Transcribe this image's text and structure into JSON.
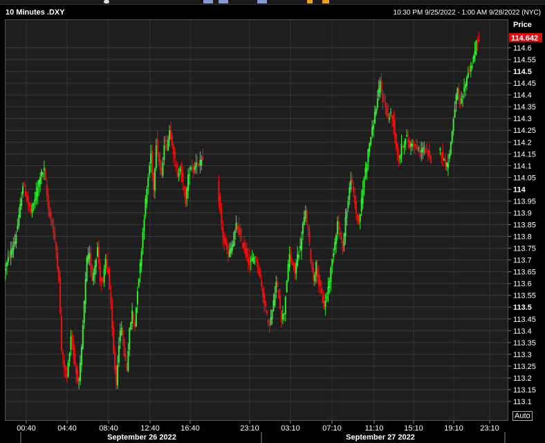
{
  "header": {
    "title": "10 Minutes .DXY",
    "date_range": "10:30 PM 9/25/2022 - 1:00 AM 9/28/2022 (NYC)"
  },
  "axis": {
    "price_header": "Price",
    "auto_label": "Auto",
    "last_price": "114.642"
  },
  "toolbar_icons": [
    "window-icon",
    "grid-icon",
    "bar-icon",
    "chart-icon",
    "warning-icon",
    "menu-icon"
  ],
  "chart_data": {
    "type": "candlestick",
    "title": "10 Minutes .DXY",
    "ylabel": "Price",
    "ylim": [
      113.03,
      114.73
    ],
    "x_tick_labels": [
      "00:40",
      "04:40",
      "08:40",
      "12:40",
      "16:40",
      "23:10",
      "03:10",
      "07:10",
      "11:10",
      "15:10",
      "19:10",
      "23:10"
    ],
    "date_labels": [
      "September 26 2022",
      "September 27 2022"
    ],
    "y_ticks": [
      113.1,
      113.15,
      113.2,
      113.25,
      113.3,
      113.35,
      113.4,
      113.45,
      113.5,
      113.55,
      113.6,
      113.65,
      113.7,
      113.75,
      113.8,
      113.85,
      113.9,
      113.95,
      114.0,
      114.05,
      114.1,
      114.15,
      114.2,
      114.25,
      114.3,
      114.35,
      114.4,
      114.45,
      114.5,
      114.55,
      114.6
    ],
    "y_tick_labels": [
      "113.1",
      "113.15",
      "113.2",
      "113.25",
      "113.3",
      "113.35",
      "113.4",
      "113.45",
      "113.5",
      "113.55",
      "113.6",
      "113.65",
      "113.7",
      "113.75",
      "113.8",
      "113.85",
      "113.9",
      "113.95",
      "114",
      "114.05",
      "114.1",
      "114.15",
      "114.2",
      "114.25",
      "114.3",
      "114.35",
      "114.4",
      "114.45",
      "114.5",
      "114.55",
      "114.6"
    ],
    "bold_ticks": [
      "113.5",
      "114",
      "114.5"
    ],
    "last_price": 114.642,
    "up_color": "#33ee33",
    "down_color": "#ee1111",
    "grid": true,
    "path": [
      [
        0,
        113.65
      ],
      [
        4,
        113.72
      ],
      [
        8,
        113.78
      ],
      [
        11,
        113.88
      ],
      [
        14,
        114.02
      ],
      [
        17,
        113.96
      ],
      [
        20,
        113.9
      ],
      [
        24,
        113.98
      ],
      [
        27,
        114.06
      ],
      [
        30,
        114.08
      ],
      [
        33,
        113.92
      ],
      [
        36,
        113.85
      ],
      [
        39,
        113.74
      ],
      [
        41,
        113.62
      ],
      [
        43,
        113.32
      ],
      [
        45,
        113.25
      ],
      [
        47,
        113.2
      ],
      [
        50,
        113.38
      ],
      [
        52,
        113.3
      ],
      [
        54,
        113.22
      ],
      [
        56,
        113.18
      ],
      [
        58,
        113.32
      ],
      [
        60,
        113.52
      ],
      [
        62,
        113.7
      ],
      [
        64,
        113.72
      ],
      [
        66,
        113.62
      ],
      [
        68,
        113.68
      ],
      [
        70,
        113.75
      ],
      [
        72,
        113.62
      ],
      [
        74,
        113.6
      ],
      [
        76,
        113.7
      ],
      [
        78,
        113.65
      ],
      [
        80,
        113.5
      ],
      [
        82,
        113.3
      ],
      [
        84,
        113.18
      ],
      [
        86,
        113.35
      ],
      [
        88,
        113.42
      ],
      [
        90,
        113.3
      ],
      [
        92,
        113.24
      ],
      [
        94,
        113.4
      ],
      [
        96,
        113.48
      ],
      [
        98,
        113.42
      ],
      [
        100,
        113.58
      ],
      [
        102,
        113.68
      ],
      [
        104,
        113.82
      ],
      [
        106,
        113.95
      ],
      [
        108,
        114.05
      ],
      [
        110,
        114.15
      ],
      [
        112,
        114.0
      ],
      [
        114,
        114.2
      ],
      [
        116,
        114.12
      ],
      [
        118,
        114.05
      ],
      [
        120,
        114.2
      ],
      [
        122,
        114.18
      ],
      [
        124,
        114.25
      ],
      [
        126,
        114.2
      ],
      [
        128,
        114.12
      ],
      [
        130,
        114.05
      ],
      [
        132,
        114.1
      ],
      [
        134,
        114.02
      ],
      [
        136,
        113.95
      ],
      [
        138,
        114.05
      ],
      [
        140,
        114.1
      ],
      [
        142,
        114.08
      ],
      [
        144,
        114.12
      ],
      [
        146,
        114.1
      ],
      [
        148,
        114.12
      ],
      [
        149,
        114.11
      ]
    ],
    "path2": [
      [
        160,
        114.02
      ],
      [
        162,
        113.9
      ],
      [
        164,
        113.8
      ],
      [
        166,
        113.76
      ],
      [
        168,
        113.72
      ],
      [
        170,
        113.75
      ],
      [
        172,
        113.78
      ],
      [
        174,
        113.85
      ],
      [
        176,
        113.82
      ],
      [
        178,
        113.78
      ],
      [
        180,
        113.75
      ],
      [
        182,
        113.72
      ],
      [
        184,
        113.68
      ],
      [
        186,
        113.7
      ],
      [
        188,
        113.72
      ],
      [
        190,
        113.68
      ],
      [
        192,
        113.62
      ],
      [
        194,
        113.55
      ],
      [
        196,
        113.5
      ],
      [
        198,
        113.42
      ],
      [
        200,
        113.45
      ],
      [
        202,
        113.52
      ],
      [
        204,
        113.6
      ],
      [
        206,
        113.55
      ],
      [
        208,
        113.45
      ],
      [
        210,
        113.48
      ],
      [
        212,
        113.62
      ],
      [
        214,
        113.72
      ],
      [
        216,
        113.68
      ],
      [
        218,
        113.65
      ],
      [
        220,
        113.72
      ],
      [
        222,
        113.75
      ],
      [
        224,
        113.85
      ],
      [
        226,
        113.9
      ],
      [
        228,
        113.82
      ],
      [
        230,
        113.7
      ],
      [
        232,
        113.62
      ],
      [
        234,
        113.68
      ],
      [
        236,
        113.6
      ],
      [
        238,
        113.55
      ],
      [
        240,
        113.5
      ],
      [
        242,
        113.55
      ],
      [
        244,
        113.62
      ],
      [
        246,
        113.7
      ],
      [
        248,
        113.78
      ],
      [
        250,
        113.86
      ],
      [
        252,
        113.8
      ],
      [
        254,
        113.75
      ],
      [
        256,
        113.88
      ],
      [
        258,
        113.95
      ],
      [
        260,
        114.05
      ],
      [
        262,
        113.98
      ],
      [
        264,
        113.9
      ],
      [
        266,
        113.85
      ],
      [
        268,
        113.95
      ],
      [
        270,
        114.05
      ],
      [
        272,
        114.12
      ],
      [
        274,
        114.2
      ],
      [
        276,
        114.25
      ],
      [
        278,
        114.32
      ],
      [
        280,
        114.38
      ],
      [
        282,
        114.45
      ],
      [
        284,
        114.38
      ],
      [
        286,
        114.35
      ],
      [
        288,
        114.3
      ],
      [
        290,
        114.32
      ],
      [
        292,
        114.28
      ],
      [
        294,
        114.18
      ],
      [
        296,
        114.12
      ],
      [
        298,
        114.18
      ],
      [
        300,
        114.2
      ],
      [
        302,
        114.22
      ],
      [
        304,
        114.18
      ],
      [
        306,
        114.2
      ],
      [
        308,
        114.18
      ],
      [
        310,
        114.17
      ],
      [
        312,
        114.15
      ],
      [
        314,
        114.18
      ],
      [
        316,
        114.16
      ],
      [
        318,
        114.15
      ],
      [
        320,
        114.12
      ]
    ],
    "path3": [
      [
        326,
        114.18
      ],
      [
        328,
        114.15
      ],
      [
        330,
        114.12
      ],
      [
        332,
        114.1
      ],
      [
        334,
        114.15
      ],
      [
        336,
        114.25
      ],
      [
        338,
        114.35
      ],
      [
        340,
        114.42
      ],
      [
        342,
        114.35
      ],
      [
        344,
        114.4
      ],
      [
        346,
        114.45
      ],
      [
        348,
        114.5
      ],
      [
        350,
        114.52
      ],
      [
        352,
        114.55
      ],
      [
        354,
        114.62
      ],
      [
        356,
        114.64
      ]
    ]
  }
}
